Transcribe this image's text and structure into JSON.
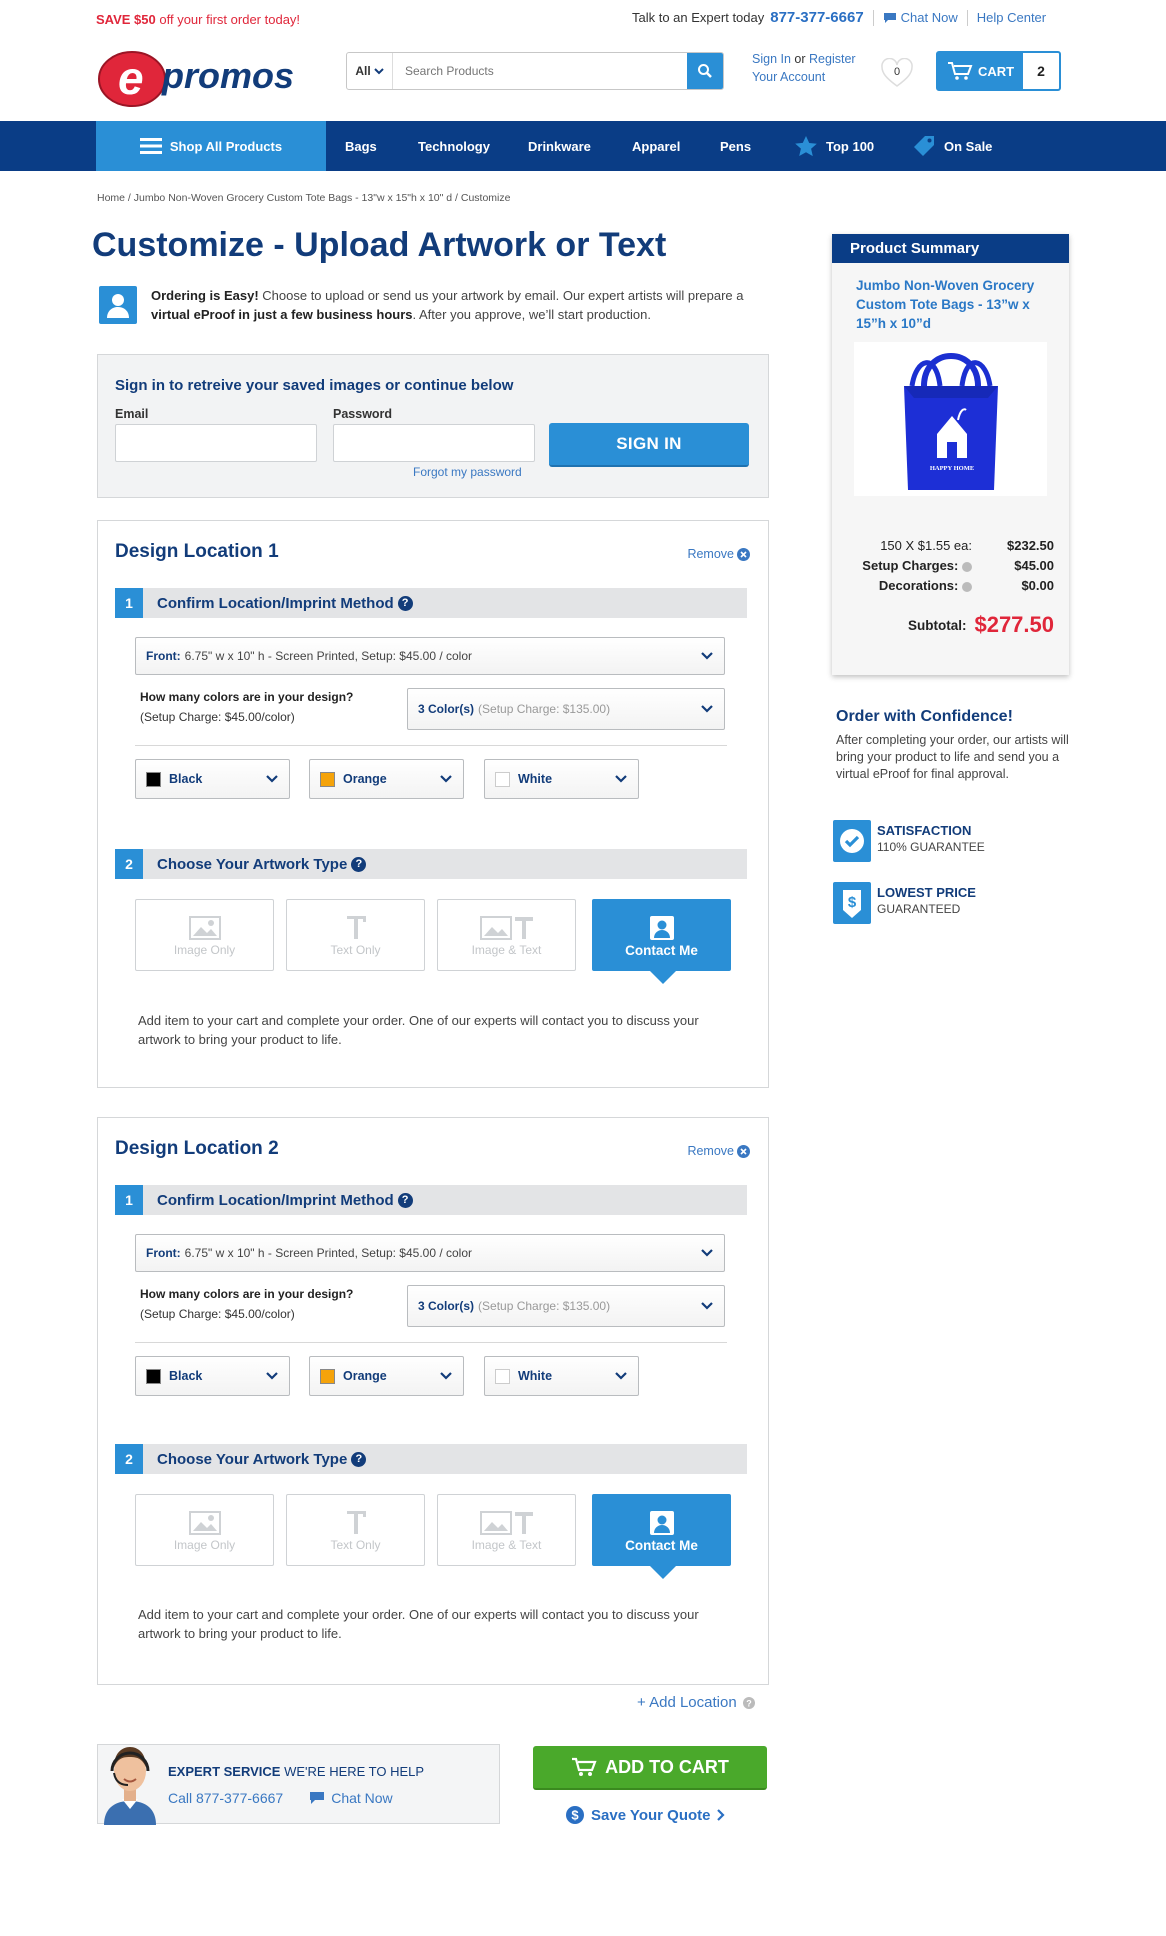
{
  "promo": {
    "save": "SAVE $50",
    "rest": "off your first order today!"
  },
  "topbar": {
    "expert_text": "Talk to an Expert today",
    "phone": "877-377-6667",
    "chat": "Chat Now",
    "help": "Help Center"
  },
  "logo": {
    "text": "epromos"
  },
  "search": {
    "category": "All",
    "placeholder": "Search Products"
  },
  "account": {
    "signin": "Sign In",
    "or": "or",
    "register": "Register",
    "your_account": "Your Account"
  },
  "wishlist": {
    "count": "0"
  },
  "cart": {
    "label": "CART",
    "count": "2"
  },
  "nav": {
    "shop_all": "Shop All Products",
    "items": [
      "Bags",
      "Technology",
      "Drinkware",
      "Apparel",
      "Pens",
      "Top 100",
      "On Sale"
    ]
  },
  "breadcrumb": "Home / Jumbo Non-Woven Grocery Custom Tote Bags - 13\"w x 15\"h x 10\" d / Customize",
  "page_title": "Customize - Upload Artwork or Text",
  "intro": {
    "bold": "Ordering is Easy!",
    "text1": " Choose to upload or send us your artwork by email. Our expert artists will prepare a ",
    "bold2": "virtual eProof in just a few business hours",
    "text2": ". After you approve, we’ll start production."
  },
  "signin_box": {
    "heading": "Sign in to retreive your saved images or continue below",
    "email_label": "Email",
    "password_label": "Password",
    "forgot": "Forgot my password",
    "button": "SIGN IN"
  },
  "locations": [
    {
      "title": "Design Location 1",
      "remove": "Remove",
      "step1": {
        "num": "1",
        "label": "Confirm Location/Imprint Method"
      },
      "location_select": {
        "bold": "Front:",
        "text": "6.75\" w x 10\" h - Screen Printed, Setup: $45.00 / color"
      },
      "colors_q": {
        "q": "How many colors are in your design?",
        "note": "(Setup Charge: $45.00/color)"
      },
      "colors_select": {
        "bold": "3 Color(s)",
        "text": "(Setup Charge: $135.00)"
      },
      "swatches": [
        {
          "name": "Black",
          "color": "#000000"
        },
        {
          "name": "Orange",
          "color": "#f5a30a"
        },
        {
          "name": "White",
          "color": "#ffffff"
        }
      ],
      "step2": {
        "num": "2",
        "label": "Choose Your Artwork Type"
      },
      "artwork_types": [
        "Image Only",
        "Text Only",
        "Image & Text",
        "Contact Me"
      ],
      "info": "Add item to your cart and complete your order. One of our experts will contact you to discuss your artwork to bring your product to life."
    },
    {
      "title": "Design Location 2",
      "remove": "Remove",
      "step1": {
        "num": "1",
        "label": "Confirm Location/Imprint Method"
      },
      "location_select": {
        "bold": "Front:",
        "text": "6.75\" w x 10\" h - Screen Printed, Setup: $45.00 / color"
      },
      "colors_q": {
        "q": "How many colors are in your design?",
        "note": "(Setup Charge: $45.00/color)"
      },
      "colors_select": {
        "bold": "3 Color(s)",
        "text": "(Setup Charge: $135.00)"
      },
      "swatches": [
        {
          "name": "Black",
          "color": "#000000"
        },
        {
          "name": "Orange",
          "color": "#f5a30a"
        },
        {
          "name": "White",
          "color": "#ffffff"
        }
      ],
      "step2": {
        "num": "2",
        "label": "Choose Your Artwork Type"
      },
      "artwork_types": [
        "Image Only",
        "Text Only",
        "Image & Text",
        "Contact Me"
      ],
      "info": "Add item to your cart and complete your order. One of our experts will contact you to discuss your artwork to bring your product to life."
    }
  ],
  "add_location": "+ Add Location",
  "expert": {
    "bold": "EXPERT SERVICE",
    "rest": "WE'RE HERE TO HELP",
    "call": "Call 877-377-6667",
    "chat": "Chat Now"
  },
  "add_to_cart": "ADD TO CART",
  "save_quote": "Save Your Quote",
  "summary": {
    "header": "Product Summary",
    "product_name": "Jumbo Non-Woven Grocery Custom Tote Bags - 13”w x 15”h x 10”d",
    "bag_text": "HAPPY HOME",
    "qty_price": "150 X $1.55 ea:",
    "qty_total": "$232.50",
    "setup_label": "Setup Charges:",
    "setup_value": "$45.00",
    "deco_label": "Decorations:",
    "deco_value": "$0.00",
    "subtotal_label": "Subtotal:",
    "subtotal_value": "$277.50"
  },
  "confidence": {
    "title": "Order with Confidence!",
    "text": "After completing your order, our artists will bring your product to life and send you a virtual eProof for final approval."
  },
  "badges": [
    {
      "title": "SATISFACTION",
      "sub": "110% GUARANTEE",
      "icon": "check-icon"
    },
    {
      "title": "LOWEST PRICE",
      "sub": "GUARANTEED",
      "icon": "dollar-tag-icon"
    }
  ],
  "colors": {
    "brand_blue": "#2a8fd6",
    "navy": "#0a3d86",
    "red": "#e0263a",
    "green": "#4aa92b"
  }
}
